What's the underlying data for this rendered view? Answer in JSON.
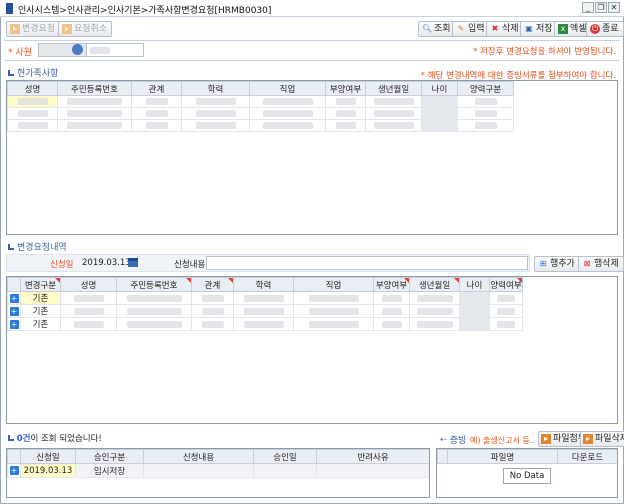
{
  "window": {
    "title": "인사시스템>인사관리>인사기본>가족사항변경요청[HRMB0030]",
    "controls": [
      "_",
      "❐",
      "✕"
    ]
  },
  "toolbar": {
    "request_label": "변경요청",
    "cancel_label": "요청취소",
    "search_label": "조회",
    "input_label": "입력",
    "delete_label": "삭제",
    "save_label": "저장",
    "excel_label": "엑셀",
    "close_label": "종료"
  },
  "employee": {
    "label": "* 사원",
    "save_note": "* 저장후 변경요청을 하셔야 반영됩니다."
  },
  "current_family": {
    "title": "현가족사항",
    "note": "* 해당 변경내역에 대한 증빙서류를 첨부하여야 합니다.",
    "columns": [
      "성명",
      "주민등록번호",
      "관계",
      "학력",
      "직업",
      "부양여부",
      "생년월일",
      "나이",
      "양력구분"
    ]
  },
  "change_request": {
    "title": "변경요청내역",
    "date_label": "신청일",
    "date_value": "2019.03.13",
    "content_label": "신청내용",
    "add_row_label": "행추가",
    "delete_row_label": "행삭제",
    "columns": [
      "변경구분",
      "성명",
      "주민등록번호",
      "관계",
      "학력",
      "직업",
      "부양여부",
      "생년월일",
      "나이",
      "양력여부"
    ],
    "rows": [
      {
        "type": "기존"
      },
      {
        "type": "기존"
      },
      {
        "type": "기존"
      }
    ]
  },
  "status": {
    "count": "0건",
    "message": "이 조회 되었습니다!"
  },
  "history": {
    "columns": [
      "신청일",
      "승인구분",
      "신청내용",
      "승인일",
      "반려사유"
    ],
    "rows": [
      {
        "date": "2019.03.13",
        "approval": "임시저장",
        "content": "",
        "approved": "",
        "reason": ""
      }
    ]
  },
  "evidence": {
    "title": "증빙",
    "example": "예) 출생신고서 등..",
    "attach_label": "파일첨부",
    "delete_label": "파일삭제",
    "columns": [
      "파일명",
      "다운로드"
    ],
    "nodata": "No Data"
  }
}
